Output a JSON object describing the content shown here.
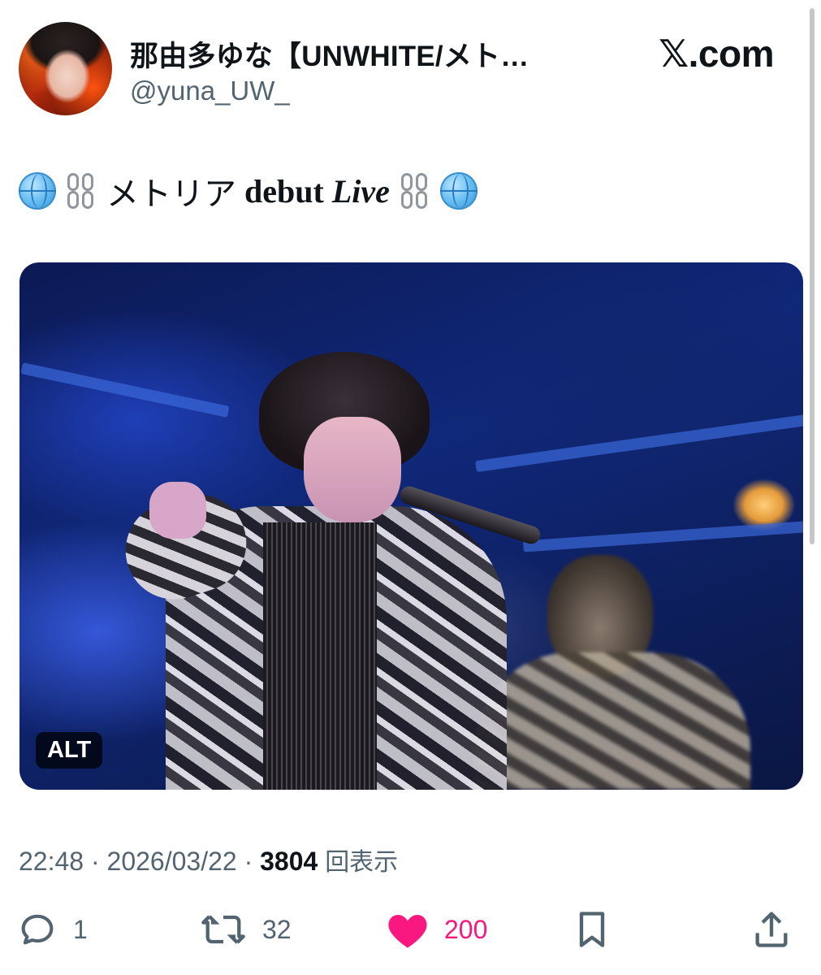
{
  "author": {
    "display_name": "那由多ゆな【UNWHITE/メト…",
    "handle": "@yuna_UW_"
  },
  "brand": {
    "label": "𝕏.com"
  },
  "tweet": {
    "text_jp": "メトリア",
    "text_debut": "debut",
    "text_live": "Live",
    "emojis": [
      "globe-emoji",
      "chain-emoji",
      "chain-emoji",
      "globe-emoji"
    ]
  },
  "media": {
    "alt_label": "ALT"
  },
  "meta": {
    "time": "22:48",
    "sep": "·",
    "date": "2026/03/22",
    "views": "3804",
    "views_label": "回表示"
  },
  "actions": {
    "reply_count": "1",
    "retweet_count": "32",
    "like_count": "200",
    "like_color": "#f91880"
  },
  "colors": {
    "text": "#0f1419",
    "secondary": "#536471",
    "like": "#f91880"
  }
}
